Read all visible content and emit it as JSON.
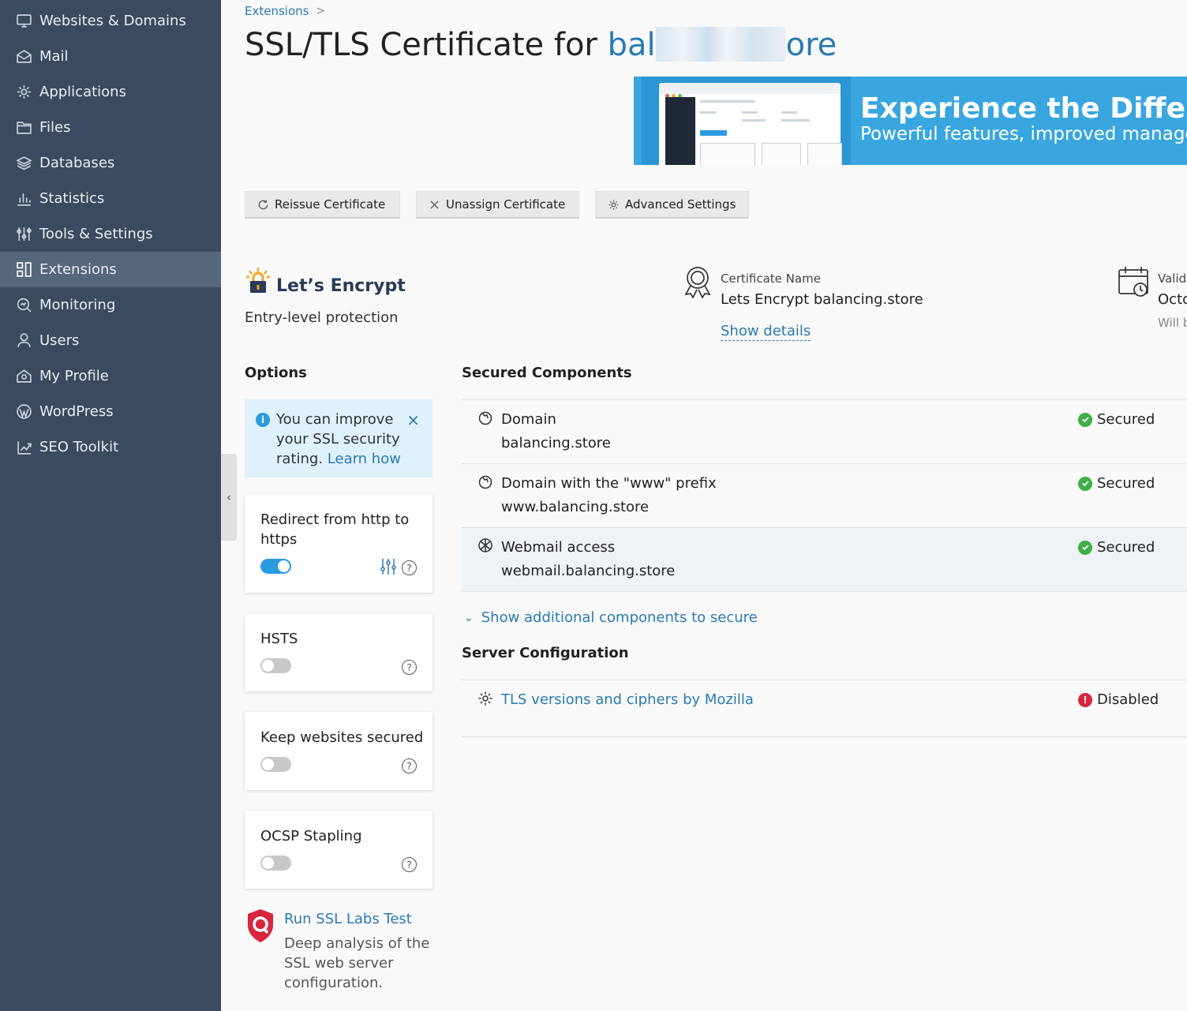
{
  "sidebar": {
    "items": [
      {
        "label": "Websites & Domains",
        "icon": "monitor-icon"
      },
      {
        "label": "Mail",
        "icon": "mail-icon"
      },
      {
        "label": "Applications",
        "icon": "gear-icon"
      },
      {
        "label": "Files",
        "icon": "folder-icon"
      },
      {
        "label": "Databases",
        "icon": "database-icon"
      },
      {
        "label": "Statistics",
        "icon": "bar-chart-icon"
      },
      {
        "label": "Tools & Settings",
        "icon": "sliders-icon"
      },
      {
        "label": "Extensions",
        "icon": "extensions-icon",
        "active": true
      },
      {
        "label": "Monitoring",
        "icon": "monitoring-icon"
      },
      {
        "label": "Users",
        "icon": "user-icon"
      },
      {
        "label": "My Profile",
        "icon": "profile-icon"
      },
      {
        "label": "WordPress",
        "icon": "wordpress-icon"
      },
      {
        "label": "SEO Toolkit",
        "icon": "seo-icon"
      }
    ]
  },
  "breadcrumb": {
    "item": "Extensions",
    "separator": ">"
  },
  "page": {
    "title_prefix": "SSL/TLS Certificate for ",
    "domain_start": "bal",
    "domain_end": "ore"
  },
  "banner": {
    "title": "Experience the Differenc",
    "subtitle": "Powerful features, improved manageme"
  },
  "toolbar": {
    "reissue": "Reissue Certificate",
    "unassign": "Unassign Certificate",
    "advanced": "Advanced Settings"
  },
  "provider": {
    "name": "Let’s Encrypt",
    "subtitle": "Entry-level protection"
  },
  "certificate": {
    "name_label": "Certificate Name",
    "name_value": "Lets Encrypt balancing.store",
    "details_link": "Show details"
  },
  "validity": {
    "label": "Valid",
    "value": "Octo",
    "note": "Will b"
  },
  "options": {
    "heading": "Options",
    "notice": {
      "text": "You can improve your SSL security rating. ",
      "link": "Learn how",
      "close": "×"
    },
    "cards": [
      {
        "label": "Redirect from http to https",
        "enabled": true
      },
      {
        "label": "HSTS",
        "enabled": false
      },
      {
        "label": "Keep websites secured",
        "enabled": false
      },
      {
        "label": "OCSP Stapling",
        "enabled": false
      }
    ],
    "ssl_test": {
      "link": "Run SSL Labs Test",
      "description": "Deep analysis of the SSL web server configuration."
    }
  },
  "secured_components": {
    "heading": "Secured Components",
    "rows": [
      {
        "title": "Domain",
        "value": "balancing.store",
        "status": "Secured"
      },
      {
        "title": "Domain with the \"www\" prefix",
        "value": "www.balancing.store",
        "status": "Secured"
      },
      {
        "title": "Webmail access",
        "value": "webmail.balancing.store",
        "status": "Secured"
      }
    ],
    "show_more": "Show additional components to secure"
  },
  "server_configuration": {
    "heading": "Server Configuration",
    "rows": [
      {
        "title": "TLS versions and ciphers by Mozilla",
        "status": "Disabled"
      }
    ]
  },
  "colors": {
    "sidebar_bg": "#3b4a5e",
    "sidebar_active": "#56667b",
    "link": "#2b7ab3",
    "toggle_on": "#2b9be0",
    "ok": "#3fae49",
    "error": "#d8263f",
    "banner": "#39a6df"
  }
}
